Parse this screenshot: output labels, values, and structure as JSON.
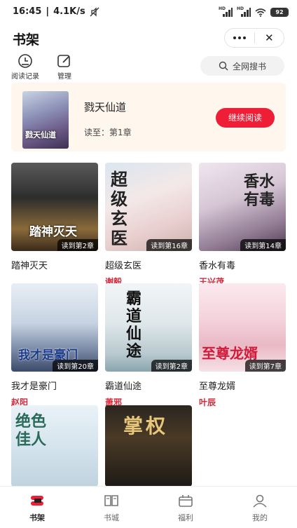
{
  "status": {
    "time": "16:45",
    "speed": "4.1K/s",
    "battery": "92"
  },
  "header": {
    "title": "书架"
  },
  "toolbar": {
    "history_label": "阅读记录",
    "manage_label": "管理",
    "search_label": "全网搜书"
  },
  "recent": {
    "title": "戮天仙道",
    "progress": "读至：第1章",
    "continue_label": "继续阅读",
    "cover_text": "戮天仙道"
  },
  "books": [
    {
      "title": "踏神灭天",
      "author": "",
      "progress": "读到第2章",
      "cover_text": "踏神灭天"
    },
    {
      "title": "超级玄医",
      "author": "谢毅",
      "progress": "读到第16章",
      "cover_text": "超级玄医"
    },
    {
      "title": "香水有毒",
      "author": "王兴茂",
      "progress": "读到第14章",
      "cover_text": "香水有毒"
    },
    {
      "title": "我才是豪门",
      "author": "赵阳",
      "progress": "读到第20章",
      "cover_text": "我才是豪门"
    },
    {
      "title": "霸道仙途",
      "author": "萧邪",
      "progress": "读到第2章",
      "cover_text": "霸道仙途"
    },
    {
      "title": "至尊龙婿",
      "author": "叶辰",
      "progress": "读到第7章",
      "cover_text": "至尊龙婿"
    },
    {
      "title": "",
      "author": "",
      "progress": "",
      "cover_text": "绝色佳人"
    },
    {
      "title": "",
      "author": "",
      "progress": "",
      "cover_text": "掌权"
    }
  ],
  "tabs": [
    {
      "label": "书架",
      "icon": "bookshelf-icon",
      "active": true
    },
    {
      "label": "书城",
      "icon": "book-icon",
      "active": false
    },
    {
      "label": "福利",
      "icon": "gift-icon",
      "active": false
    },
    {
      "label": "我的",
      "icon": "user-icon",
      "active": false
    }
  ],
  "colors": {
    "accent": "#ef1e37",
    "author": "#d8283a",
    "recent_bg": "#fff7ee"
  }
}
